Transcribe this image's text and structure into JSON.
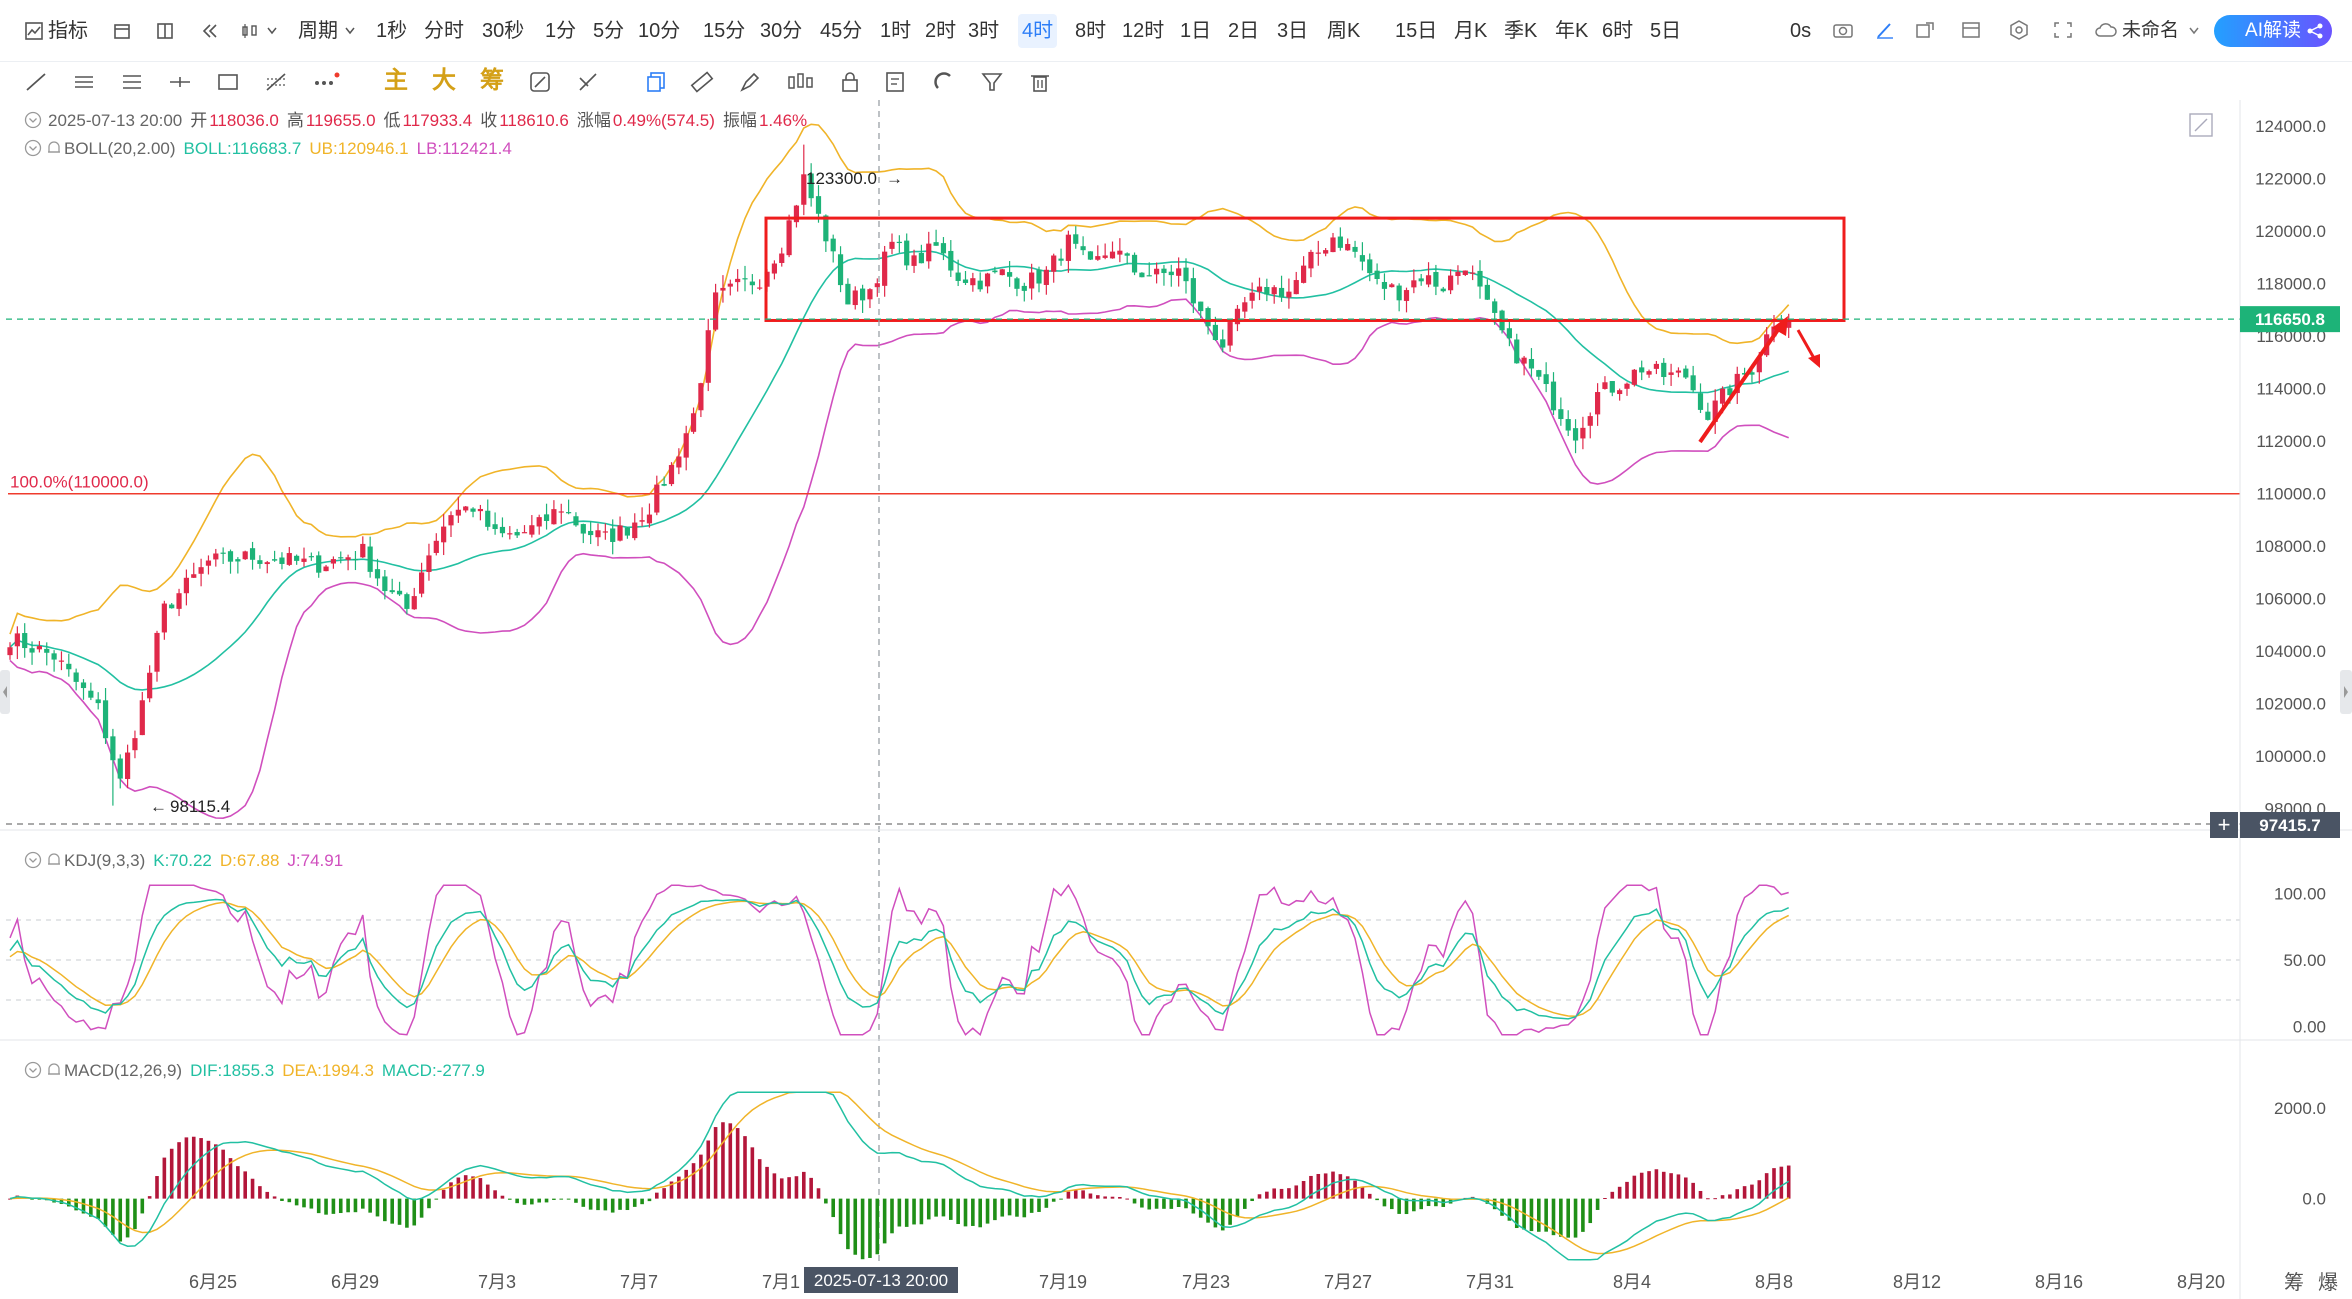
{
  "toolbar": {
    "indicator_label": "指标",
    "period_label": "周期",
    "periods": [
      "1秒",
      "分时",
      "30秒",
      "1分",
      "5分",
      "10分",
      "15分",
      "30分",
      "45分",
      "1时",
      "2时",
      "3时",
      "4时",
      "8时",
      "12时",
      "1日",
      "2日",
      "3日",
      "周K",
      "15日",
      "月K",
      "季K",
      "年K",
      "6时",
      "5日"
    ],
    "active_period": "4时",
    "countdown": "0s",
    "layout_name": "未命名",
    "ai_button": "AI解读",
    "draw_tools": [
      "line-tool-icon",
      "hline-tool-icon",
      "channel-tool-icon",
      "segment-tool-icon",
      "rect-tool-icon",
      "fib-tool-icon",
      "more-tools-icon"
    ],
    "main_chip": "主",
    "big_chip": "大",
    "chip_label": "筹"
  },
  "colors": {
    "up": "#e0294a",
    "down": "#1db378",
    "boll_mid": "#22c0a2",
    "boll_upper": "#f0b429",
    "boll_lower": "#d04fbe",
    "kdj_k": "#22c0a2",
    "kdj_d": "#f0b429",
    "kdj_j": "#d04fbe",
    "macd_pos": "#b3163a",
    "macd_neg": "#1f8f17",
    "annotation": "#ef1c1c",
    "accent": "#2d7ef7"
  },
  "ohlc_info": {
    "date": "2025-07-13 20:00",
    "open_label": "开",
    "open": "118036.0",
    "high_label": "高",
    "high": "119655.0",
    "low_label": "低",
    "low": "117933.4",
    "close_label": "收",
    "close": "118610.6",
    "change_label": "涨幅",
    "change": "0.49%(574.5)",
    "amp_label": "振幅",
    "amp": "1.46%"
  },
  "boll_legend": {
    "name": "BOLL(20,2.00)",
    "mid": "BOLL:116683.7",
    "upper": "UB:120946.1",
    "lower": "LB:112421.4"
  },
  "kdj_legend": {
    "name": "KDJ(9,3,3)",
    "k": "K:70.22",
    "d": "D:67.88",
    "j": "J:74.91"
  },
  "macd_legend": {
    "name": "MACD(12,26,9)",
    "dif": "DIF:1855.3",
    "dea": "DEA:1994.3",
    "macd": "MACD:-277.9"
  },
  "chart_data": [
    {
      "type": "candlestick",
      "ylim": [
        97415.7,
        125000
      ],
      "y_ticks": [
        "124000.0",
        "122000.0",
        "120000.0",
        "118000.0",
        "116000.0",
        "114000.0",
        "112000.0",
        "110000.0",
        "108000.0",
        "106000.0",
        "104000.0",
        "102000.0",
        "100000.0",
        "98000.0"
      ],
      "x_tick_labels": [
        "6月25",
        "6月29",
        "7月3",
        "7月7",
        "7月1",
        "7月19",
        "7月23",
        "7月27",
        "7月31",
        "8月4",
        "8月8",
        "8月12",
        "8月16",
        "8月20"
      ],
      "crosshair_time": "2025-07-13 20:00",
      "last_price": "116650.8",
      "cursor_price": "97415.7",
      "max_label": "123300.0",
      "min_label": "98115.4",
      "fib_label": "100.0%(110000.0)",
      "fib_level": 110000,
      "range_box": {
        "top": 120500,
        "bottom": 116600
      },
      "price_anchors": [
        [
          0,
          104500
        ],
        [
          6,
          103800
        ],
        [
          12,
          101800
        ],
        [
          15,
          99000
        ],
        [
          18,
          102000
        ],
        [
          21,
          105600
        ],
        [
          27,
          107400
        ],
        [
          33,
          107600
        ],
        [
          42,
          107300
        ],
        [
          48,
          107800
        ],
        [
          51,
          106400
        ],
        [
          54,
          105600
        ],
        [
          57,
          107800
        ],
        [
          60,
          109300
        ],
        [
          63,
          109500
        ],
        [
          66,
          108400
        ],
        [
          69,
          108400
        ],
        [
          72,
          108800
        ],
        [
          75,
          109500
        ],
        [
          78,
          108600
        ],
        [
          81,
          108300
        ],
        [
          84,
          108700
        ],
        [
          87,
          109500
        ],
        [
          90,
          111000
        ],
        [
          93,
          113000
        ],
        [
          96,
          117400
        ],
        [
          99,
          117900
        ],
        [
          102,
          118200
        ],
        [
          105,
          119500
        ],
        [
          108,
          122000
        ],
        [
          111,
          119800
        ],
        [
          114,
          117300
        ],
        [
          117,
          117800
        ],
        [
          120,
          119500
        ],
        [
          123,
          118800
        ],
        [
          126,
          119400
        ],
        [
          129,
          118300
        ],
        [
          132,
          118100
        ],
        [
          135,
          118400
        ],
        [
          138,
          118000
        ],
        [
          141,
          118400
        ],
        [
          144,
          119600
        ],
        [
          147,
          118600
        ],
        [
          150,
          119400
        ],
        [
          153,
          118500
        ],
        [
          156,
          118300
        ],
        [
          159,
          118500
        ],
        [
          162,
          116800
        ],
        [
          165,
          115700
        ],
        [
          168,
          117200
        ],
        [
          171,
          117800
        ],
        [
          174,
          117700
        ],
        [
          177,
          118900
        ],
        [
          180,
          119800
        ],
        [
          183,
          119200
        ],
        [
          186,
          118000
        ],
        [
          189,
          117700
        ],
        [
          192,
          118300
        ],
        [
          195,
          117900
        ],
        [
          198,
          118800
        ],
        [
          201,
          117100
        ],
        [
          204,
          115600
        ],
        [
          207,
          114700
        ],
        [
          210,
          113500
        ],
        [
          213,
          112300
        ],
        [
          216,
          113800
        ],
        [
          219,
          114200
        ],
        [
          222,
          114800
        ],
        [
          225,
          114500
        ],
        [
          228,
          114500
        ],
        [
          231,
          113000
        ],
        [
          234,
          114000
        ],
        [
          237,
          114800
        ],
        [
          240,
          116600
        ],
        [
          242,
          116650
        ]
      ]
    },
    {
      "type": "line",
      "name": "KDJ",
      "y_ticks": [
        "100.00",
        "50.00",
        "0.00"
      ],
      "ylim": [
        -10,
        110
      ]
    },
    {
      "type": "bar",
      "name": "MACD",
      "y_ticks": [
        "2000.0",
        "0.0"
      ],
      "ylim": [
        -1400,
        2400
      ]
    }
  ],
  "right_badge_labels": [
    "筹",
    "爆"
  ]
}
